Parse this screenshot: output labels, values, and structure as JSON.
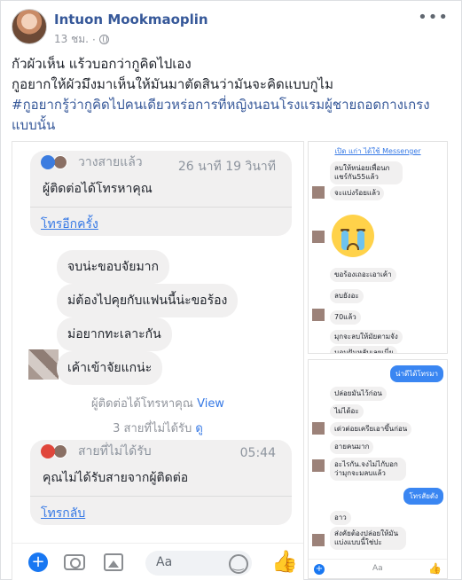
{
  "post": {
    "author": "Intuon Mookmaoplin",
    "time": "13 ชม.",
    "separator": "·",
    "more_icon": "more-dots-icon",
    "privacy_icon": "globe-icon",
    "lines": [
      "กัวผัวเห็น แร้วบอกว่ากูคิดไปเอง",
      "กูอยากให้ผัวมึงมาเห็นให้มันมาตัดสินว่ามันจะคิดแบบกูไม"
    ],
    "hashtag": "#กูอยากรู้ว่ากูคิดไปคนเดียวหร่อการที่หญิงนอนโรงแรมผู้ชายถอดกางเกรงแบบนั้น"
  },
  "left_screenshot": {
    "card1": {
      "status": "วางสายแล้ว",
      "time": "26 นาที 19 วินาที",
      "title": "ผู้ติดต่อได้โทรหาคุณ",
      "action": "โทรอีกครั้ง"
    },
    "bubbles": [
      "จบน่ะขอบจัยมาก",
      "ม่ต้องไปคุยกับแฟนนี้น่ะขอร้อง",
      "ม่อยากทะเลาะกัน",
      "เค้าเข้าจัยแกน่ะ"
    ],
    "note1": {
      "text": "ผู้ติดต่อได้โทรหาคุณ",
      "link": "View"
    },
    "note2": {
      "text": "3 สายที่ไม่ได้รับ",
      "link": "ดู"
    },
    "card2": {
      "status": "สายที่ไม่ได้รับ",
      "time": "05:44",
      "title": "คุณไม่ได้รับสายจากผู้ติดต่อ",
      "action": "โทรกลับ"
    },
    "composer": {
      "placeholder": "Aa"
    }
  },
  "right_top_screenshot": {
    "header": "เปิด แก่า ได้ใช้ Messenger",
    "messages": [
      "ลบให้หน่อยเพื่อนกแชร์กัน55แล้ว",
      "จะแบ่งร้อยแล้ว",
      "ขอร้องเถอะเอาเค้า",
      "ลบยังอะ",
      "70แล้ว",
      "มุกจะลบให้มัยตามจัง",
      "นอนฝันหลับเลยเนี่ย"
    ]
  },
  "right_bottom_screenshot": {
    "sent": [
      "น่าดีได้โทรมา",
      "โทรสัยดัง"
    ],
    "messages": [
      "ปล่อยมันไว้ก่อน",
      "ไม่ได้อะ",
      "เด่วต่อยเครียเอาขึ้นก่อน",
      "อายคนมาก",
      "อะไรกัน.จงไม่ไกับอกว่ามุกจะมลบแล้ว",
      "อาว",
      "ส่งคัยต้องปล่อยให้มันแบ่งแบบนี้ใช่ปะ"
    ],
    "composer": {
      "placeholder": "Aa"
    }
  }
}
